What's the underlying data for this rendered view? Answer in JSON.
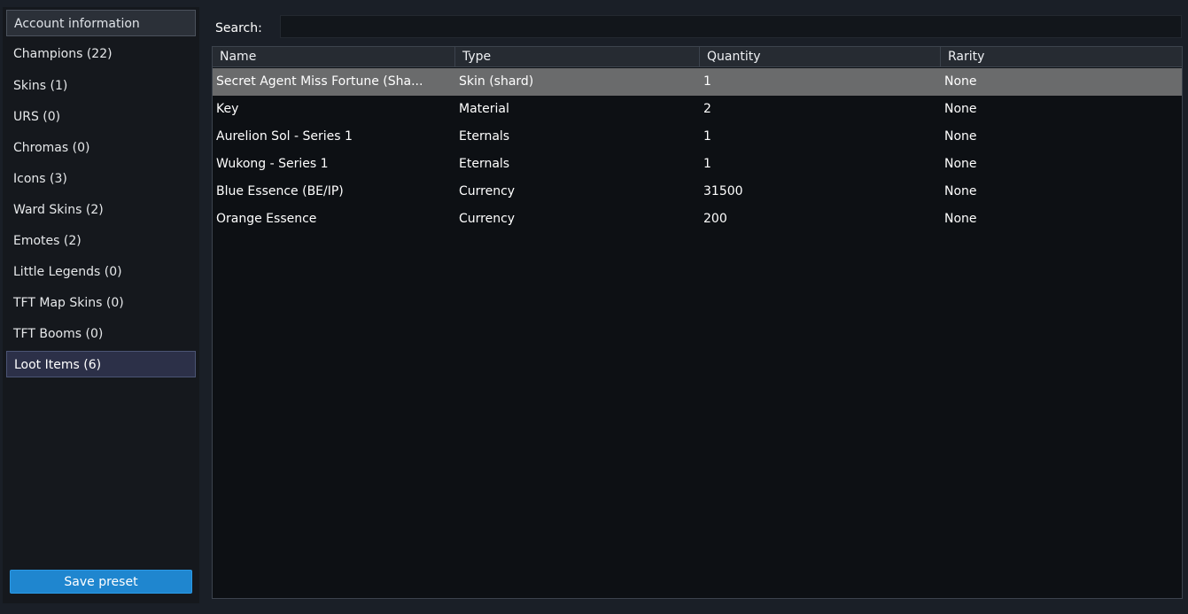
{
  "sidebar": {
    "items": [
      {
        "label": "Account information"
      },
      {
        "label": "Champions (22)"
      },
      {
        "label": "Skins (1)"
      },
      {
        "label": "URS (0)"
      },
      {
        "label": "Chromas (0)"
      },
      {
        "label": "Icons (3)"
      },
      {
        "label": "Ward Skins (2)"
      },
      {
        "label": "Emotes (2)"
      },
      {
        "label": "Little Legends (0)"
      },
      {
        "label": "TFT Map Skins (0)"
      },
      {
        "label": "TFT Booms (0)"
      },
      {
        "label": "Loot Items (6)"
      }
    ],
    "active_item": "Loot Items (6)",
    "save_label": "Save preset"
  },
  "search": {
    "label": "Search:",
    "value": ""
  },
  "table": {
    "columns": [
      "Name",
      "Type",
      "Quantity",
      "Rarity"
    ],
    "rows": [
      {
        "name": "Secret Agent Miss Fortune (Sha...",
        "type": "Skin (shard)",
        "quantity": "1",
        "rarity": "None",
        "selected": true
      },
      {
        "name": "Key",
        "type": "Material",
        "quantity": "2",
        "rarity": "None"
      },
      {
        "name": "Aurelion Sol - Series 1",
        "type": "Eternals",
        "quantity": "1",
        "rarity": "None"
      },
      {
        "name": "Wukong - Series 1",
        "type": "Eternals",
        "quantity": "1",
        "rarity": "None"
      },
      {
        "name": "Blue Essence (BE/IP)",
        "type": "Currency",
        "quantity": "31500",
        "rarity": "None"
      },
      {
        "name": "Orange Essence",
        "type": "Currency",
        "quantity": "200",
        "rarity": "None"
      }
    ]
  },
  "colors": {
    "background": "#1a1f27",
    "selected_row": "#6a6b6c",
    "active_nav": "#2c3048",
    "button": "#1f86cf"
  }
}
